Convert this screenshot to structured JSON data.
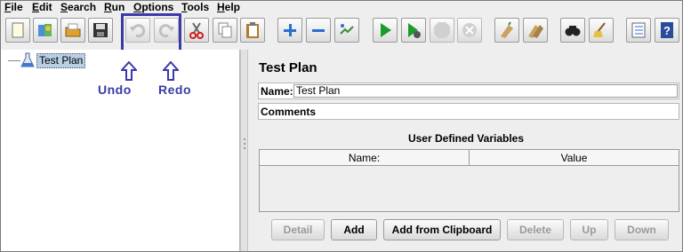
{
  "menu": {
    "items": [
      {
        "mnemonic": "F",
        "rest": "ile"
      },
      {
        "mnemonic": "E",
        "rest": "dit"
      },
      {
        "mnemonic": "S",
        "rest": "earch"
      },
      {
        "mnemonic": "R",
        "rest": "un"
      },
      {
        "mnemonic": "O",
        "rest": "ptions"
      },
      {
        "mnemonic": "T",
        "rest": "ools"
      },
      {
        "mnemonic": "H",
        "rest": "elp"
      }
    ]
  },
  "toolbar": {
    "buttons": [
      {
        "icon": "new-icon",
        "enabled": true
      },
      {
        "icon": "templates-icon",
        "enabled": true
      },
      {
        "icon": "open-icon",
        "enabled": true
      },
      {
        "icon": "save-icon",
        "enabled": true
      },
      {
        "icon": "undo-icon",
        "enabled": false
      },
      {
        "icon": "redo-icon",
        "enabled": false
      },
      {
        "icon": "cut-icon",
        "enabled": true
      },
      {
        "icon": "copy-icon",
        "enabled": true
      },
      {
        "icon": "paste-icon",
        "enabled": true
      },
      {
        "icon": "expand-icon",
        "enabled": true
      },
      {
        "icon": "collapse-icon",
        "enabled": true
      },
      {
        "icon": "toggle-icon",
        "enabled": true
      },
      {
        "icon": "start-icon",
        "enabled": true
      },
      {
        "icon": "start-no-pauses-icon",
        "enabled": true
      },
      {
        "icon": "stop-icon",
        "enabled": false
      },
      {
        "icon": "shutdown-icon",
        "enabled": false
      },
      {
        "icon": "clear-icon",
        "enabled": true
      },
      {
        "icon": "clear-all-icon",
        "enabled": true
      },
      {
        "icon": "search-icon",
        "enabled": true
      },
      {
        "icon": "reset-search-icon",
        "enabled": true
      },
      {
        "icon": "function-helper-icon",
        "enabled": true
      },
      {
        "icon": "help-icon",
        "enabled": true
      }
    ]
  },
  "tree": {
    "root_label": "Test Plan"
  },
  "annotations": {
    "undo": "Undo",
    "redo": "Redo",
    "color": "#3a3aa8"
  },
  "panel": {
    "title": "Test Plan",
    "name_label": "Name:",
    "name_value": "Test Plan",
    "comments_label": "Comments:",
    "comments_value": "",
    "variables_title": "User Defined Variables",
    "columns": [
      "Name:",
      "Value"
    ]
  },
  "buttons": {
    "detail": "Detail",
    "add": "Add",
    "add_from_clipboard": "Add from Clipboard",
    "delete": "Delete",
    "up": "Up",
    "down": "Down"
  }
}
